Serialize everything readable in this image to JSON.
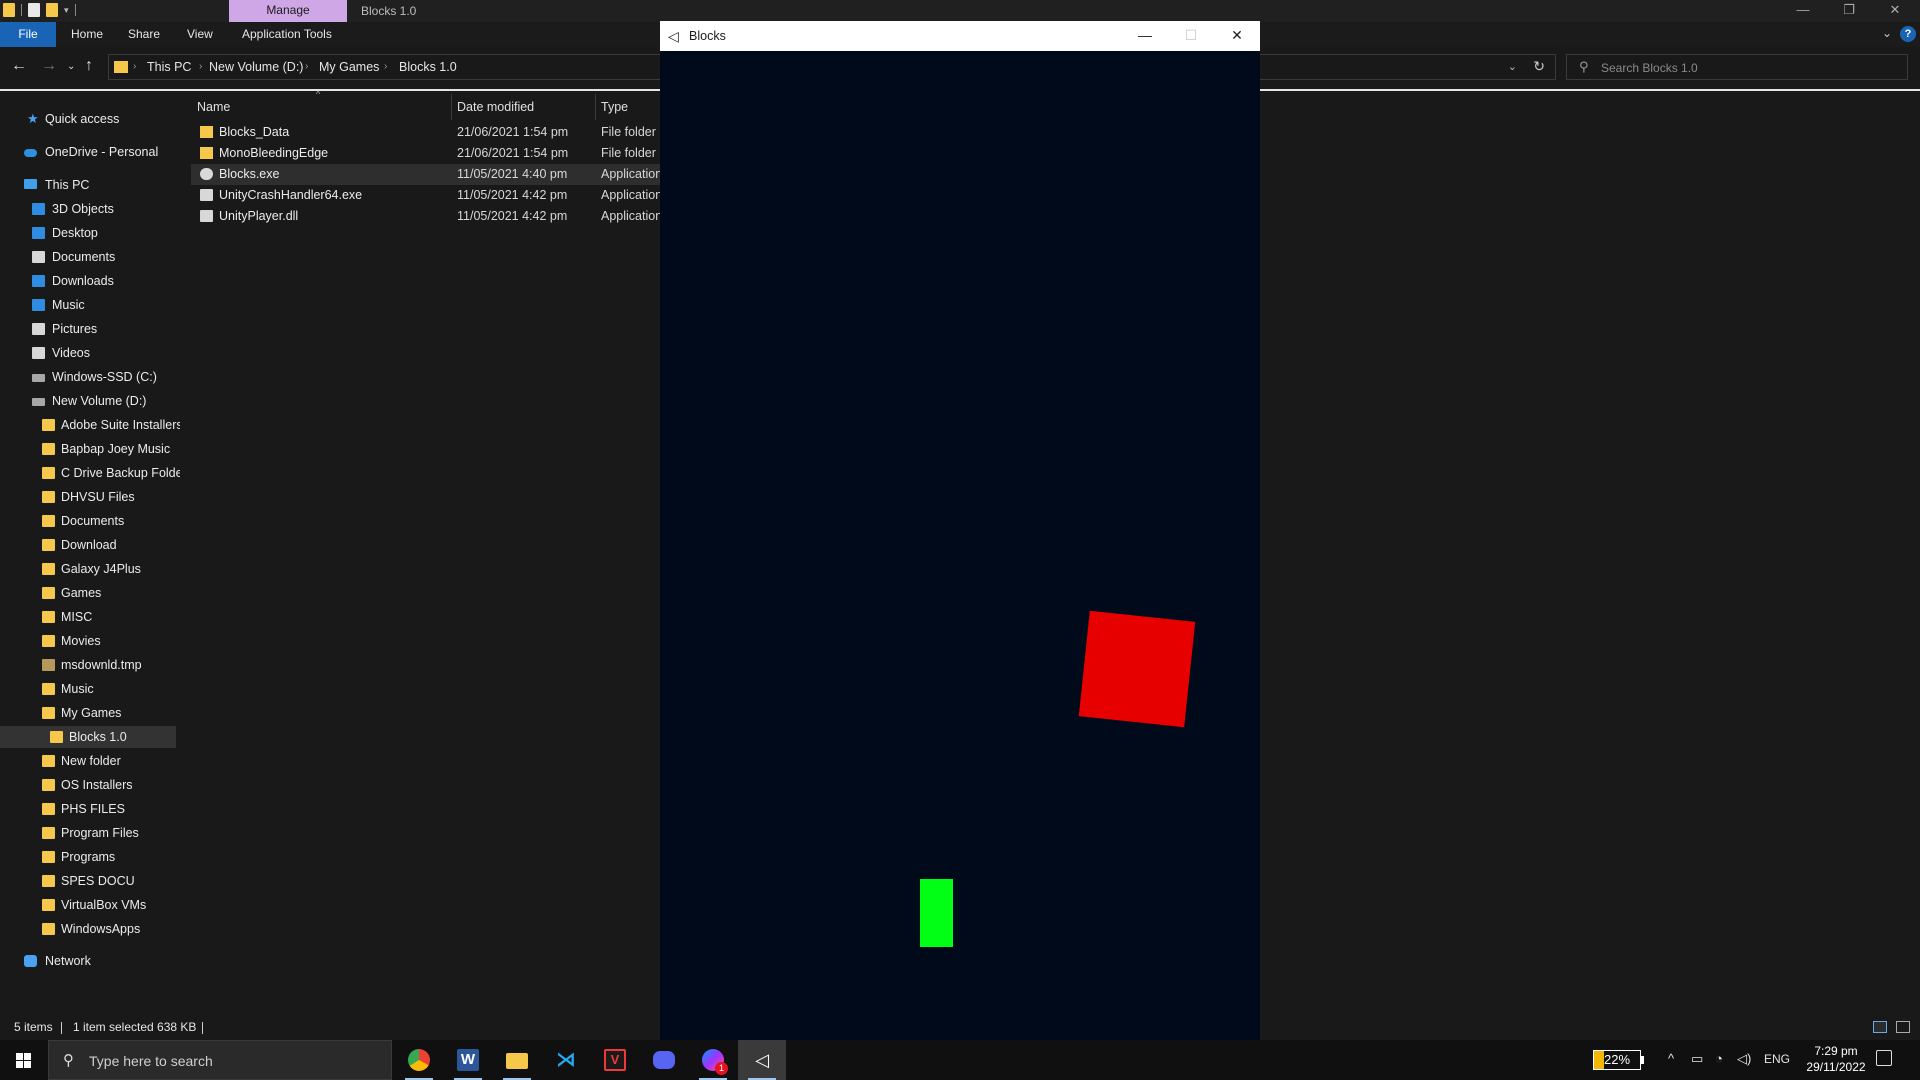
{
  "titlebar": {
    "context_tab": "Manage",
    "window_title": "Blocks 1.0"
  },
  "ribbon": {
    "tabs": [
      "File",
      "Home",
      "Share",
      "View",
      "Application Tools"
    ]
  },
  "address": {
    "crumbs": [
      "This PC",
      "New Volume (D:)",
      "My Games",
      "Blocks 1.0"
    ]
  },
  "search": {
    "placeholder": "Search Blocks 1.0"
  },
  "nav": {
    "items": [
      {
        "label": "Quick access",
        "icon": "star-icon"
      },
      {
        "label": "OneDrive - Personal",
        "icon": "cloud-icon"
      },
      {
        "label": "This PC",
        "icon": "pc-icon"
      },
      {
        "label": "3D Objects",
        "icon": "cube-icon"
      },
      {
        "label": "Desktop",
        "icon": "desktop-icon"
      },
      {
        "label": "Documents",
        "icon": "document-icon"
      },
      {
        "label": "Downloads",
        "icon": "download-icon"
      },
      {
        "label": "Music",
        "icon": "music-icon"
      },
      {
        "label": "Pictures",
        "icon": "picture-icon"
      },
      {
        "label": "Videos",
        "icon": "video-icon"
      },
      {
        "label": "Windows-SSD (C:)",
        "icon": "drive-icon"
      },
      {
        "label": "New Volume (D:)",
        "icon": "drive-icon"
      },
      {
        "label": "Adobe Suite Installers",
        "icon": "folder-icon"
      },
      {
        "label": "Bapbap Joey Music",
        "icon": "folder-icon"
      },
      {
        "label": "C Drive Backup Folder",
        "icon": "folder-icon"
      },
      {
        "label": "DHVSU Files",
        "icon": "folder-icon"
      },
      {
        "label": "Documents",
        "icon": "folder-icon"
      },
      {
        "label": "Download",
        "icon": "folder-icon"
      },
      {
        "label": "Galaxy J4Plus",
        "icon": "folder-icon"
      },
      {
        "label": "Games",
        "icon": "folder-icon"
      },
      {
        "label": "MISC",
        "icon": "folder-icon"
      },
      {
        "label": "Movies",
        "icon": "folder-icon"
      },
      {
        "label": "msdownld.tmp",
        "icon": "folder-icon"
      },
      {
        "label": "Music",
        "icon": "folder-icon"
      },
      {
        "label": "My Games",
        "icon": "folder-icon"
      },
      {
        "label": "Blocks 1.0",
        "icon": "folder-icon"
      },
      {
        "label": "New folder",
        "icon": "folder-icon"
      },
      {
        "label": "OS Installers",
        "icon": "folder-icon"
      },
      {
        "label": "PHS FILES",
        "icon": "folder-icon"
      },
      {
        "label": "Program Files",
        "icon": "folder-icon"
      },
      {
        "label": "Programs",
        "icon": "folder-icon"
      },
      {
        "label": "SPES DOCU",
        "icon": "folder-icon"
      },
      {
        "label": "VirtualBox VMs",
        "icon": "folder-icon"
      },
      {
        "label": "WindowsApps",
        "icon": "folder-icon"
      },
      {
        "label": "Network",
        "icon": "network-icon"
      }
    ],
    "selected": "Blocks 1.0"
  },
  "list": {
    "columns": [
      "Name",
      "Date modified",
      "Type"
    ],
    "rows": [
      {
        "name": "Blocks_Data",
        "date": "21/06/2021 1:54 pm",
        "type": "File folder"
      },
      {
        "name": "MonoBleedingEdge",
        "date": "21/06/2021 1:54 pm",
        "type": "File folder"
      },
      {
        "name": "Blocks.exe",
        "date": "11/05/2021 4:40 pm",
        "type": "Application"
      },
      {
        "name": "UnityCrashHandler64.exe",
        "date": "11/05/2021 4:42 pm",
        "type": "Application"
      },
      {
        "name": "UnityPlayer.dll",
        "date": "11/05/2021 4:42 pm",
        "type": "Application"
      }
    ],
    "selected_row": "Blocks.exe"
  },
  "status": {
    "count": "5 items",
    "selection": "1 item selected  638 KB"
  },
  "game": {
    "title": "Blocks",
    "background": "#000a1a",
    "block_color": "#e60000",
    "paddle_color": "#00ff14"
  },
  "taskbar": {
    "search_placeholder": "Type here to search",
    "apps": [
      "chrome-icon",
      "word-icon",
      "file-explorer-icon",
      "vscode-icon",
      "vivaldi-icon",
      "discord-icon",
      "messenger-icon",
      "unity-icon"
    ],
    "notification_badge": "1",
    "battery": "22%",
    "language": "ENG",
    "time": "7:29 pm",
    "date": "29/11/2022"
  }
}
